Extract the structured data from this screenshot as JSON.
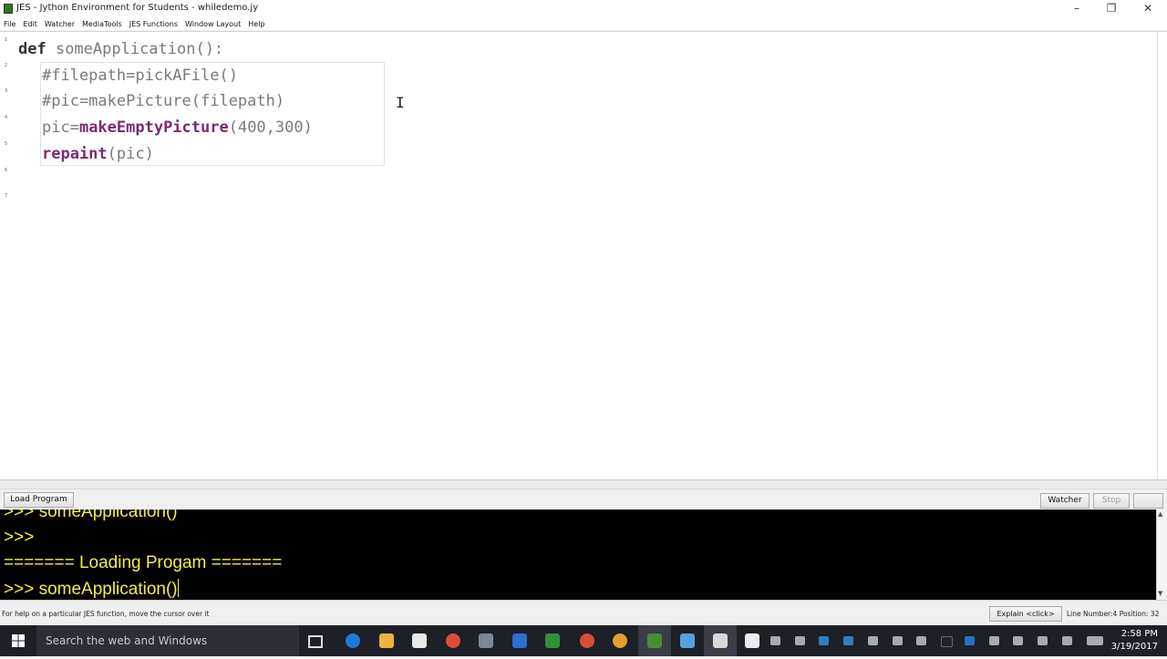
{
  "window": {
    "title": "JES - Jython Environment for Students - whiledemo.jy",
    "controls": {
      "minimize": "–",
      "restore": "❐",
      "close": "✕"
    }
  },
  "menu": [
    "File",
    "Edit",
    "Watcher",
    "MediaTools",
    "JES Functions",
    "Window Layout",
    "Help"
  ],
  "editor": {
    "line_numbers": [
      "1",
      "2",
      "3",
      "4",
      "5",
      "6",
      "7"
    ],
    "lines": {
      "l1_kw": "def",
      "l1_rest": " someApplication():",
      "l2": "#filepath=pickAFile()",
      "l3": "#pic=makePicture(filepath)",
      "l4_a": "pic=",
      "l4_fn": "makeEmptyPicture",
      "l4_b": "(400,300)",
      "l5_fn": "repaint",
      "l5_b": "(pic)"
    },
    "cursor_glyph": "I"
  },
  "buttons": {
    "load_program": "Load Program",
    "watcher": "Watcher",
    "stop": "Stop"
  },
  "console": {
    "lines": [
      ">>> someApplication()",
      ">>>",
      "======= Loading Progam =======",
      ">>> someApplication()"
    ]
  },
  "statusbar": {
    "help": "For help on a particular JES function, move the cursor over it",
    "explain": "Explain <click>",
    "position": "Line Number:4 Position: 32"
  },
  "taskbar": {
    "search_placeholder": "Search the web and Windows",
    "time": "2:58 PM",
    "date": "3/19/2017"
  },
  "colors": {
    "console_bg": "#000000",
    "console_text": "#f2ee4a",
    "keyword": "#333333",
    "function": "#7b2a6e",
    "taskbar": "#1e2027"
  }
}
